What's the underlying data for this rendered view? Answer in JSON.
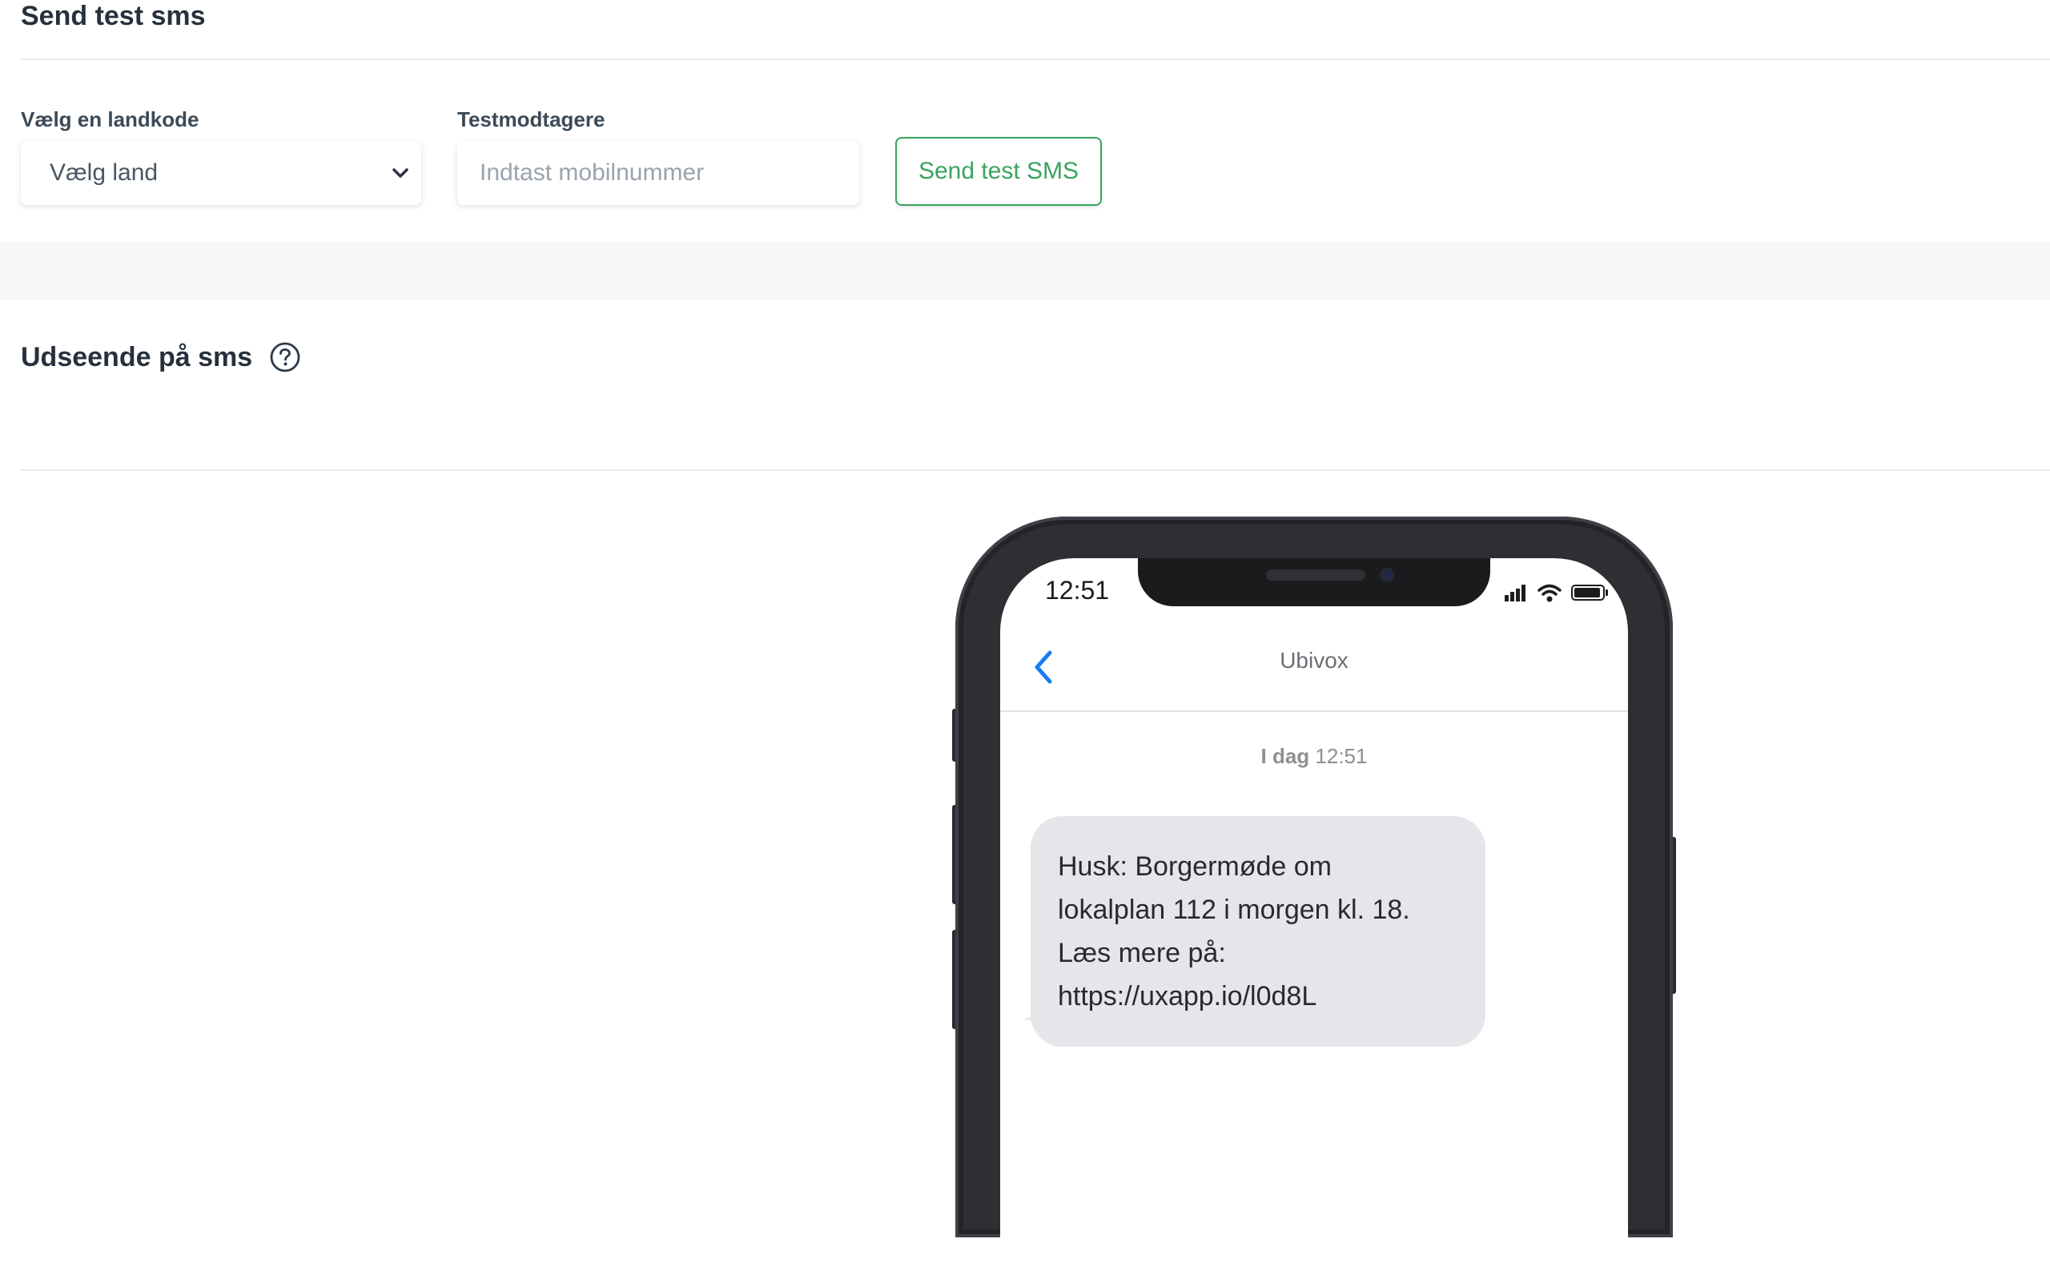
{
  "colors": {
    "accent": "#3aa35f",
    "bubble": "#e5e5ea",
    "ios_blue": "#1a7cf5"
  },
  "test_section": {
    "title": "Send test sms",
    "country_label": "Vælg en landkode",
    "country_select": {
      "selected": "Vælg land"
    },
    "recipients_label": "Testmodtagere",
    "recipients_input": {
      "placeholder": "Indtast mobilnummer",
      "value": ""
    },
    "send_button": "Send test SMS"
  },
  "appearance_section": {
    "title": "Udseende på sms",
    "help_icon": "question-circle-icon"
  },
  "phone": {
    "status_time": "12:51",
    "status_icons": [
      "signal-icon",
      "wifi-icon",
      "battery-icon"
    ],
    "back_icon": "chevron-left-icon",
    "contact_name": "Ubivox",
    "timestamp_day": "I dag",
    "timestamp_time": "12:51",
    "message_lines": [
      "Husk: Borgermøde om",
      "lokalplan 112 i morgen kl. 18.",
      "Læs mere på:",
      "https://uxapp.io/l0d8L"
    ]
  }
}
